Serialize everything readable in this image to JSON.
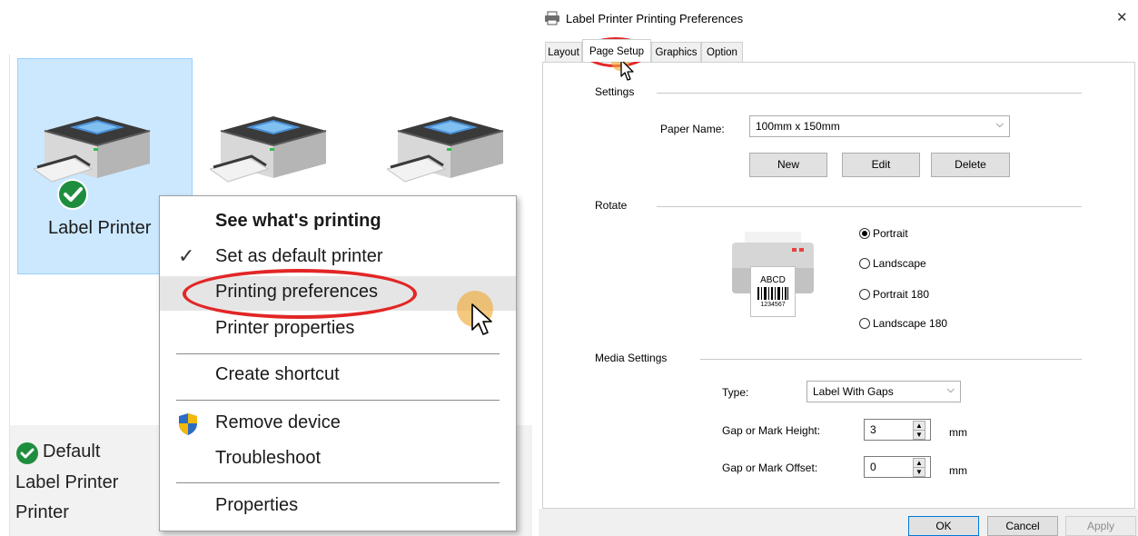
{
  "explorer": {
    "selected_printer_label": "Label Printer",
    "context_menu": {
      "items": [
        {
          "label": "See what's printing"
        },
        {
          "label": "Set as default printer"
        },
        {
          "label": "Printing preferences"
        },
        {
          "label": "Printer properties"
        },
        {
          "label": "Create shortcut"
        },
        {
          "label": "Remove device"
        },
        {
          "label": "Troubleshoot"
        },
        {
          "label": "Properties"
        }
      ]
    },
    "details": {
      "status": "Default",
      "line2": "Label Printer",
      "line3": "Printer"
    }
  },
  "dialog": {
    "title": "Label Printer Printing Preferences",
    "close_glyph": "✕",
    "tabs": [
      "Layout",
      "Page Setup",
      "Graphics",
      "Option"
    ],
    "active_tab": "Page Setup",
    "settings": {
      "group_label": "Settings",
      "paper_name_label": "Paper Name:",
      "paper_name_value": "100mm x 150mm",
      "buttons": {
        "new": "New",
        "edit": "Edit",
        "delete": "Delete"
      }
    },
    "rotate": {
      "group_label": "Rotate",
      "preview_text": "ABCD",
      "preview_number": "1234567",
      "options": [
        "Portrait",
        "Landscape",
        "Portrait 180",
        "Landscape 180"
      ],
      "selected": "Portrait"
    },
    "media": {
      "group_label": "Media Settings",
      "type_label": "Type:",
      "type_value": "Label With Gaps",
      "gap_height_label": "Gap or Mark Height:",
      "gap_height_value": "3",
      "gap_offset_label": "Gap or Mark Offset:",
      "gap_offset_value": "0",
      "unit": "mm"
    },
    "footer": {
      "ok": "OK",
      "cancel": "Cancel",
      "apply": "Apply"
    }
  },
  "colors": {
    "selection_bg": "#cce8ff",
    "annotation_red": "#e22626",
    "check_green": "#1e8e3e"
  }
}
